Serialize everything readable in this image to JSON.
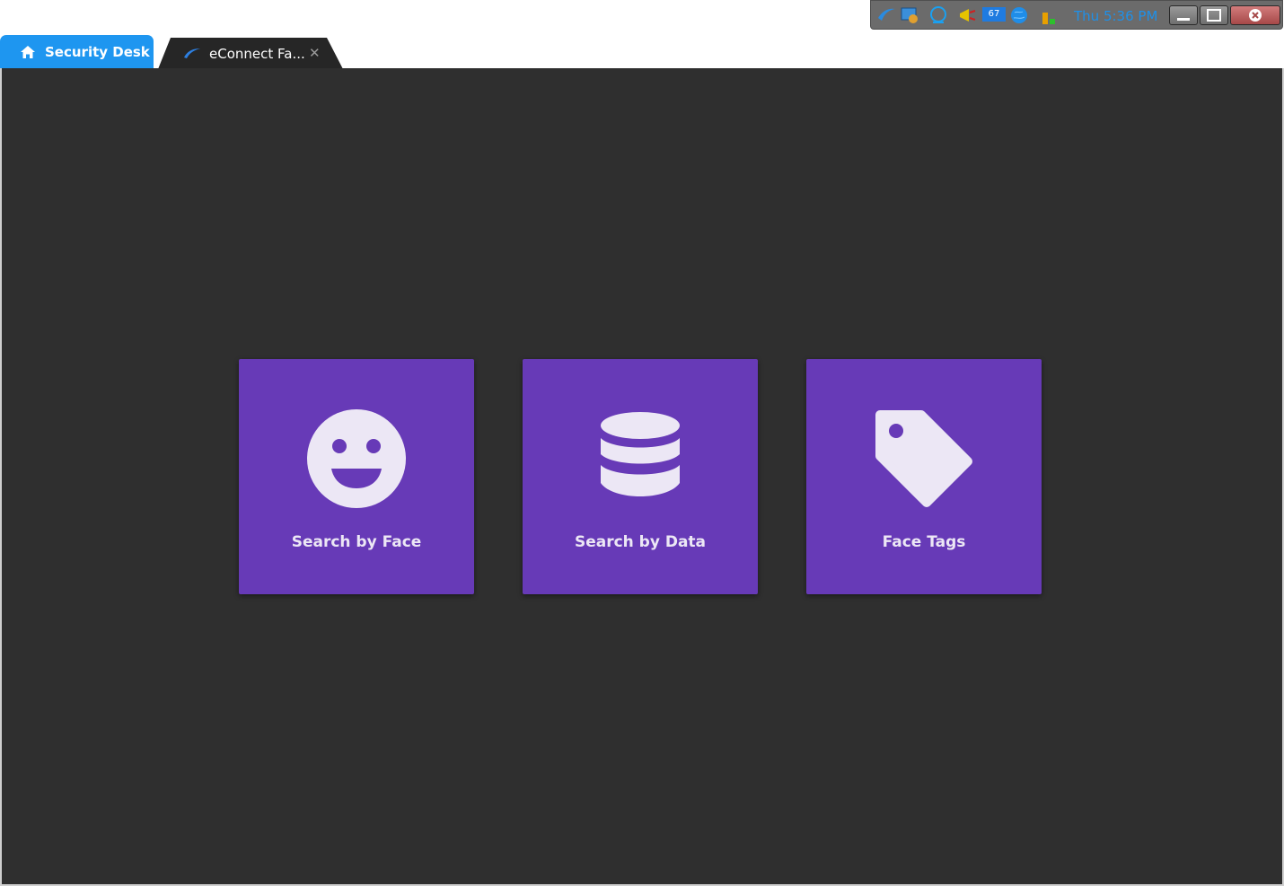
{
  "tray": {
    "badge": "67",
    "time": "Thu 5:36 PM",
    "icons": [
      "feather-icon",
      "screen-icon",
      "globe-icon",
      "megaphone-icon",
      "network-badge-icon",
      "earth-icon",
      "bar-chart-icon"
    ]
  },
  "tabs": [
    {
      "label": "Security Desk",
      "icon": "home-icon",
      "active": true
    },
    {
      "label": "eConnect Fa...",
      "icon": "feather-logo-icon",
      "close": "✕"
    }
  ],
  "tiles": [
    {
      "label": "Search by Face",
      "icon": "smiley-face-icon"
    },
    {
      "label": "Search by Data",
      "icon": "database-icon"
    },
    {
      "label": "Face Tags",
      "icon": "tag-icon"
    }
  ],
  "colors": {
    "accent": "#1e96f0",
    "tile": "#673ab7",
    "tile_icon": "#ece7f5",
    "background": "#2f2f2f"
  }
}
